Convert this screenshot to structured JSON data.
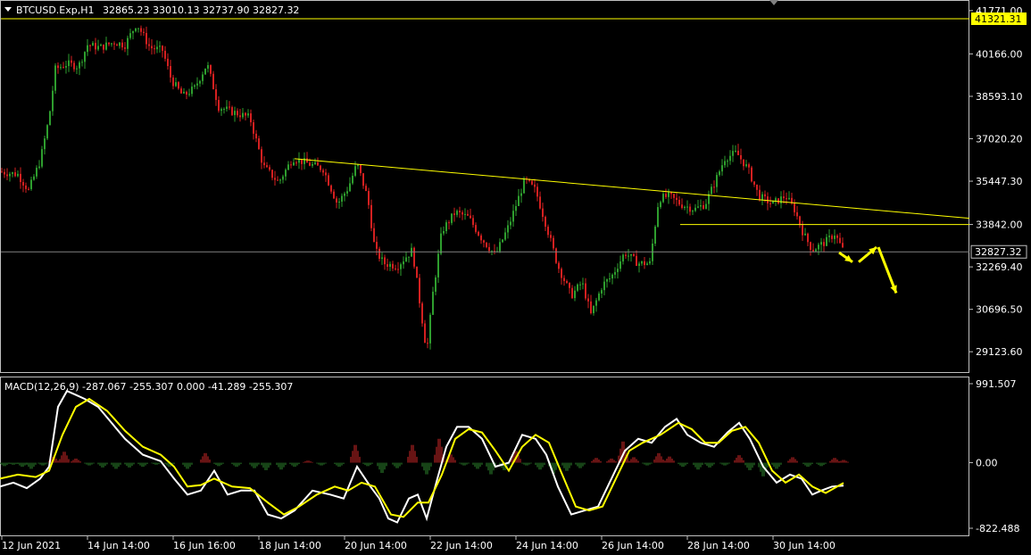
{
  "window": {
    "title": "BTCUSD.Exp,H1",
    "ohlc": "32865.23 33010.13 32737.90 32827.32",
    "menu_icon": "triangle-down-icon"
  },
  "price_panel": {
    "y_ticks": [
      "41771.00",
      "40166.00",
      "38593.10",
      "37020.20",
      "35447.30",
      "33842.00",
      "32269.40",
      "30696.50",
      "29123.60"
    ],
    "current_price_label": "32827.32",
    "alert_line_label": "41321.31",
    "colors": {
      "bull": "#2e9e2e",
      "bear": "#d42020",
      "trend": "#ffff00",
      "grid": "#808080"
    }
  },
  "macd_panel": {
    "label": "MACD(12,26,9) -287.067 -255.307 0.000 -41.289 -255.307",
    "y_ticks": [
      "991.507",
      "0.00",
      "-822.488"
    ],
    "colors": {
      "macd": "#ffffff",
      "signal": "#ffff00",
      "hist_pos": "#8b1a1a",
      "hist_neg": "#1f5a1f"
    }
  },
  "time_axis": {
    "labels": [
      "12 Jun 2021",
      "14 Jun 14:00",
      "16 Jun 16:00",
      "18 Jun 14:00",
      "20 Jun 14:00",
      "22 Jun 14:00",
      "24 Jun 14:00",
      "26 Jun 14:00",
      "28 Jun 14:00",
      "30 Jun 14:00"
    ]
  },
  "chart_data": {
    "type": "candlestick",
    "symbol": "BTCUSD.Exp",
    "timeframe": "H1",
    "price_range": [
      28700,
      41900
    ],
    "price_path": [
      [
        0,
        35800
      ],
      [
        20,
        35700
      ],
      [
        32,
        35100
      ],
      [
        45,
        36200
      ],
      [
        55,
        37800
      ],
      [
        62,
        39600
      ],
      [
        75,
        39800
      ],
      [
        88,
        39700
      ],
      [
        98,
        40500
      ],
      [
        112,
        40400
      ],
      [
        128,
        40600
      ],
      [
        140,
        40500
      ],
      [
        153,
        41300
      ],
      [
        168,
        40400
      ],
      [
        182,
        40300
      ],
      [
        192,
        39200
      ],
      [
        205,
        38600
      ],
      [
        218,
        38900
      ],
      [
        232,
        39800
      ],
      [
        245,
        38200
      ],
      [
        262,
        38000
      ],
      [
        280,
        37800
      ],
      [
        295,
        36000
      ],
      [
        312,
        35400
      ],
      [
        328,
        36300
      ],
      [
        345,
        36100
      ],
      [
        362,
        35900
      ],
      [
        378,
        34600
      ],
      [
        390,
        35200
      ],
      [
        400,
        36100
      ],
      [
        412,
        34800
      ],
      [
        420,
        32900
      ],
      [
        430,
        32400
      ],
      [
        445,
        32300
      ],
      [
        462,
        32900
      ],
      [
        478,
        29100
      ],
      [
        485,
        31300
      ],
      [
        495,
        33600
      ],
      [
        510,
        34300
      ],
      [
        525,
        34100
      ],
      [
        540,
        33300
      ],
      [
        555,
        32700
      ],
      [
        570,
        33800
      ],
      [
        588,
        35500
      ],
      [
        600,
        35100
      ],
      [
        612,
        33800
      ],
      [
        625,
        32300
      ],
      [
        640,
        31200
      ],
      [
        652,
        31700
      ],
      [
        662,
        30500
      ],
      [
        675,
        31600
      ],
      [
        685,
        31900
      ],
      [
        700,
        32800
      ],
      [
        715,
        32400
      ],
      [
        728,
        32400
      ],
      [
        738,
        34800
      ],
      [
        750,
        34900
      ],
      [
        762,
        34600
      ],
      [
        778,
        34400
      ],
      [
        790,
        34600
      ],
      [
        802,
        35500
      ],
      [
        812,
        36300
      ],
      [
        825,
        36500
      ],
      [
        838,
        35900
      ],
      [
        850,
        34900
      ],
      [
        865,
        34600
      ],
      [
        880,
        34900
      ],
      [
        890,
        34400
      ],
      [
        900,
        33500
      ],
      [
        910,
        32900
      ],
      [
        925,
        33200
      ],
      [
        935,
        33500
      ],
      [
        945,
        32850
      ]
    ],
    "trendline": {
      "from": {
        "x": "18 Jun 14:00",
        "y": 36280
      },
      "to": {
        "x": "01 Jul 2021",
        "y": 34070
      }
    },
    "support_line": {
      "price": 33842,
      "from": "27 Jun 2021",
      "to": "01 Jul 2021"
    },
    "current_price": 32827.32,
    "alert_level": 41321.31,
    "projection_arrows": [
      {
        "from": 32800,
        "to": 32450
      },
      {
        "from": 32450,
        "to": 33000
      },
      {
        "from": 33000,
        "to": 31300
      }
    ],
    "macd": {
      "params": [
        12,
        26,
        9
      ],
      "range": [
        -822.488,
        991.507
      ],
      "values": {
        "main": -287.067,
        "signal": -255.307,
        "hist": -41.289
      },
      "main_line": [
        [
          0,
          -300
        ],
        [
          15,
          -250
        ],
        [
          30,
          -320
        ],
        [
          45,
          -200
        ],
        [
          55,
          -50
        ],
        [
          65,
          700
        ],
        [
          75,
          900
        ],
        [
          85,
          850
        ],
        [
          95,
          800
        ],
        [
          110,
          700
        ],
        [
          125,
          500
        ],
        [
          140,
          300
        ],
        [
          160,
          100
        ],
        [
          180,
          20
        ],
        [
          195,
          -200
        ],
        [
          210,
          -400
        ],
        [
          225,
          -350
        ],
        [
          240,
          -100
        ],
        [
          255,
          -400
        ],
        [
          270,
          -350
        ],
        [
          285,
          -350
        ],
        [
          300,
          -650
        ],
        [
          315,
          -700
        ],
        [
          330,
          -600
        ],
        [
          350,
          -350
        ],
        [
          370,
          -400
        ],
        [
          385,
          -450
        ],
        [
          400,
          -50
        ],
        [
          415,
          -300
        ],
        [
          425,
          -450
        ],
        [
          435,
          -700
        ],
        [
          445,
          -750
        ],
        [
          458,
          -450
        ],
        [
          468,
          -400
        ],
        [
          478,
          -700
        ],
        [
          490,
          -200
        ],
        [
          500,
          200
        ],
        [
          512,
          450
        ],
        [
          525,
          450
        ],
        [
          540,
          300
        ],
        [
          555,
          -50
        ],
        [
          570,
          0
        ],
        [
          585,
          350
        ],
        [
          600,
          300
        ],
        [
          612,
          100
        ],
        [
          625,
          -300
        ],
        [
          640,
          -650
        ],
        [
          655,
          -600
        ],
        [
          670,
          -550
        ],
        [
          685,
          -200
        ],
        [
          700,
          150
        ],
        [
          715,
          300
        ],
        [
          730,
          250
        ],
        [
          745,
          450
        ],
        [
          758,
          550
        ],
        [
          770,
          350
        ],
        [
          785,
          250
        ],
        [
          800,
          200
        ],
        [
          815,
          380
        ],
        [
          828,
          500
        ],
        [
          840,
          300
        ],
        [
          855,
          -50
        ],
        [
          870,
          -250
        ],
        [
          885,
          -150
        ],
        [
          898,
          -200
        ],
        [
          910,
          -400
        ],
        [
          920,
          -350
        ],
        [
          932,
          -300
        ],
        [
          945,
          -287
        ]
      ],
      "signal_line": [
        [
          0,
          -200
        ],
        [
          20,
          -150
        ],
        [
          40,
          -180
        ],
        [
          55,
          -100
        ],
        [
          70,
          350
        ],
        [
          85,
          700
        ],
        [
          100,
          800
        ],
        [
          120,
          650
        ],
        [
          140,
          400
        ],
        [
          160,
          200
        ],
        [
          180,
          100
        ],
        [
          195,
          -50
        ],
        [
          210,
          -300
        ],
        [
          225,
          -280
        ],
        [
          240,
          -200
        ],
        [
          260,
          -300
        ],
        [
          280,
          -320
        ],
        [
          300,
          -500
        ],
        [
          318,
          -650
        ],
        [
          335,
          -550
        ],
        [
          355,
          -400
        ],
        [
          375,
          -300
        ],
        [
          390,
          -350
        ],
        [
          405,
          -250
        ],
        [
          420,
          -300
        ],
        [
          438,
          -650
        ],
        [
          452,
          -680
        ],
        [
          468,
          -500
        ],
        [
          480,
          -500
        ],
        [
          495,
          -150
        ],
        [
          510,
          300
        ],
        [
          525,
          420
        ],
        [
          540,
          380
        ],
        [
          555,
          150
        ],
        [
          570,
          -100
        ],
        [
          585,
          200
        ],
        [
          600,
          350
        ],
        [
          615,
          250
        ],
        [
          628,
          -100
        ],
        [
          645,
          -550
        ],
        [
          660,
          -600
        ],
        [
          675,
          -550
        ],
        [
          690,
          -200
        ],
        [
          705,
          150
        ],
        [
          720,
          250
        ],
        [
          740,
          350
        ],
        [
          760,
          500
        ],
        [
          775,
          420
        ],
        [
          790,
          250
        ],
        [
          805,
          250
        ],
        [
          820,
          400
        ],
        [
          835,
          450
        ],
        [
          850,
          250
        ],
        [
          865,
          -100
        ],
        [
          880,
          -250
        ],
        [
          895,
          -150
        ],
        [
          910,
          -300
        ],
        [
          925,
          -380
        ],
        [
          945,
          -255
        ]
      ],
      "histogram": [
        [
          5,
          -50
        ],
        [
          15,
          -30
        ],
        [
          25,
          -60
        ],
        [
          35,
          -90
        ],
        [
          48,
          -40
        ],
        [
          60,
          90
        ],
        [
          72,
          160
        ],
        [
          85,
          60
        ],
        [
          100,
          -40
        ],
        [
          115,
          -70
        ],
        [
          130,
          -90
        ],
        [
          145,
          -70
        ],
        [
          160,
          -60
        ],
        [
          175,
          -30
        ],
        [
          190,
          -60
        ],
        [
          210,
          -90
        ],
        [
          230,
          140
        ],
        [
          245,
          -50
        ],
        [
          265,
          -60
        ],
        [
          285,
          -80
        ],
        [
          298,
          -110
        ],
        [
          315,
          -100
        ],
        [
          330,
          -60
        ],
        [
          345,
          30
        ],
        [
          360,
          -40
        ],
        [
          380,
          -60
        ],
        [
          398,
          260
        ],
        [
          412,
          -50
        ],
        [
          428,
          -150
        ],
        [
          445,
          -80
        ],
        [
          462,
          260
        ],
        [
          478,
          -170
        ],
        [
          492,
          350
        ],
        [
          505,
          120
        ],
        [
          520,
          -40
        ],
        [
          535,
          -90
        ],
        [
          550,
          -170
        ],
        [
          565,
          -110
        ],
        [
          578,
          170
        ],
        [
          590,
          -40
        ],
        [
          605,
          -100
        ],
        [
          620,
          -160
        ],
        [
          635,
          -120
        ],
        [
          650,
          -80
        ],
        [
          668,
          70
        ],
        [
          685,
          60
        ],
        [
          698,
          310
        ],
        [
          710,
          80
        ],
        [
          725,
          -40
        ],
        [
          738,
          140
        ],
        [
          750,
          90
        ],
        [
          765,
          -60
        ],
        [
          782,
          -100
        ],
        [
          795,
          -70
        ],
        [
          812,
          -40
        ],
        [
          828,
          110
        ],
        [
          840,
          -110
        ],
        [
          855,
          -200
        ],
        [
          870,
          -90
        ],
        [
          888,
          80
        ],
        [
          905,
          -60
        ],
        [
          920,
          -50
        ],
        [
          935,
          70
        ],
        [
          945,
          40
        ]
      ]
    },
    "x_labels": [
      "12 Jun 2021",
      "14 Jun 14:00",
      "16 Jun 16:00",
      "18 Jun 14:00",
      "20 Jun 14:00",
      "22 Jun 14:00",
      "24 Jun 14:00",
      "26 Jun 14:00",
      "28 Jun 14:00",
      "30 Jun 14:00"
    ]
  }
}
